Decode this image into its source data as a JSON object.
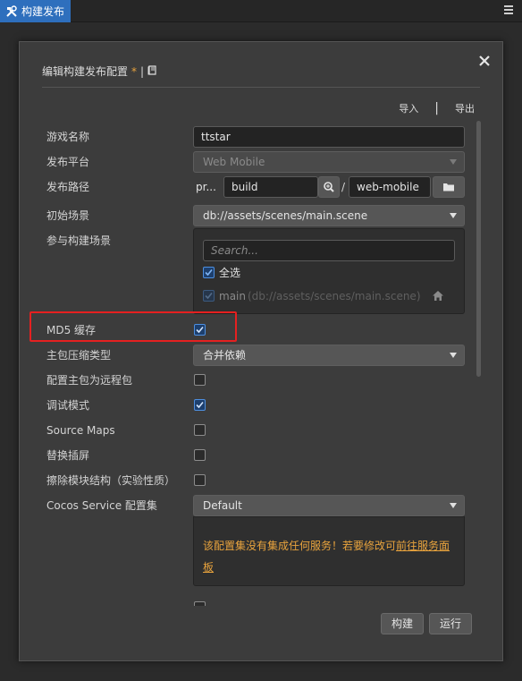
{
  "tab": {
    "label": "构建发布"
  },
  "dialog": {
    "title": "编辑构建发布配置",
    "modified_mark": "*",
    "title_sep": "|",
    "import_label": "导入",
    "export_label": "导出",
    "io_sep": "|"
  },
  "form": {
    "game_name": {
      "label": "游戏名称",
      "value": "ttstar"
    },
    "platform": {
      "label": "发布平台",
      "value": "Web Mobile"
    },
    "build_path": {
      "label": "发布路径",
      "prefix": "pr...",
      "folder": "build",
      "sep": "/",
      "sub": "web-mobile"
    },
    "start_scene": {
      "label": "初始场景",
      "value": "db://assets/scenes/main.scene"
    },
    "scenes": {
      "label": "参与构建场景",
      "search_placeholder": "Search...",
      "select_all": "全选",
      "items": [
        {
          "name": "main",
          "path": "(db://assets/scenes/main.scene)",
          "checked": true
        }
      ]
    },
    "md5": {
      "label": "MD5 缓存",
      "checked": true
    },
    "compress": {
      "label": "主包压缩类型",
      "value": "合并依赖"
    },
    "remote_main": {
      "label": "配置主包为远程包",
      "checked": false
    },
    "debug": {
      "label": "调试模式",
      "checked": true
    },
    "source_maps": {
      "label": "Source Maps",
      "checked": false
    },
    "replace_splash": {
      "label": "替换插屏",
      "checked": false
    },
    "erase_modules": {
      "label": "擦除模块结构（实验性质）",
      "checked": false
    },
    "cocos_service": {
      "label": "Cocos Service 配置集",
      "value": "Default"
    },
    "service_warning": {
      "text": "该配置集没有集成任何服务！若要修改可",
      "link": "前往服务面板"
    }
  },
  "footer": {
    "build_label": "构建",
    "run_label": "运行"
  },
  "colors": {
    "accent": "#2e6fbd",
    "warning": "#e8a33d",
    "highlight": "#e52020"
  }
}
